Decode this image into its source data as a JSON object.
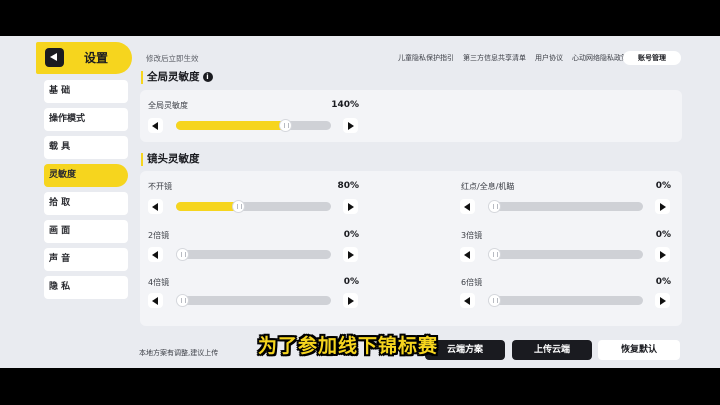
{
  "sidebar": {
    "title": "设置",
    "items": [
      {
        "label": "基 础",
        "active": false
      },
      {
        "label": "操作模式",
        "active": false
      },
      {
        "label": "载 具",
        "active": false
      },
      {
        "label": "灵敏度",
        "active": true
      },
      {
        "label": "拾 取",
        "active": false
      },
      {
        "label": "画 面",
        "active": false
      },
      {
        "label": "声 音",
        "active": false
      },
      {
        "label": "隐 私",
        "active": false
      }
    ]
  },
  "topbar": {
    "hint": "修改后立即生效",
    "links": [
      "儿童隐私保护指引",
      "第三方信息共享清单",
      "用户协议",
      "心动网络隐私政策"
    ],
    "account_button": "账号管理"
  },
  "global_section": {
    "title": "全局灵敏度",
    "info_icon": "i",
    "sliders": [
      {
        "label": "全局灵敏度",
        "value_text": "140%",
        "fraction": 0.7
      }
    ]
  },
  "scope_section": {
    "title": "镜头灵敏度",
    "sliders_left": [
      {
        "label": "不开镜",
        "value_text": "80%",
        "fraction": 0.4
      },
      {
        "label": "2倍镜",
        "value_text": "0%",
        "fraction": 0
      },
      {
        "label": "4倍镜",
        "value_text": "0%",
        "fraction": 0
      }
    ],
    "sliders_right": [
      {
        "label": "红点/全息/机瞄",
        "value_text": "0%",
        "fraction": 0
      },
      {
        "label": "3倍镜",
        "value_text": "0%",
        "fraction": 0
      },
      {
        "label": "6倍镜",
        "value_text": "0%",
        "fraction": 0
      }
    ]
  },
  "bottom": {
    "hint": "本地方案有调整,建议上传",
    "cloud_plan_button": "云端方案",
    "upload_button": "上传云端",
    "restore_button": "恢复默认"
  },
  "caption": "为了参加线下锦标赛",
  "colors": {
    "accent": "#f6d51e",
    "dark": "#1a1b20",
    "background": "#e9ebf0"
  }
}
